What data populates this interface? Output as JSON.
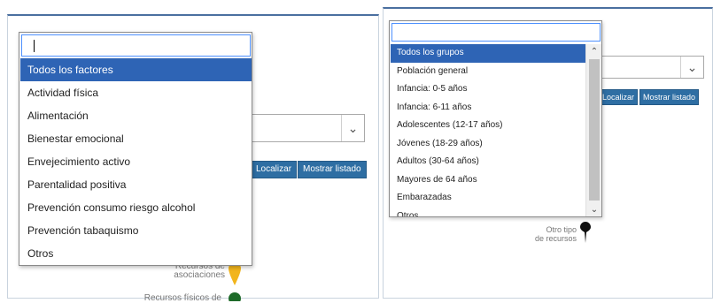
{
  "left": {
    "dropdown": {
      "search_value": "",
      "options": [
        "Todos los factores",
        "Actividad física",
        "Alimentación",
        "Bienestar emocional",
        "Envejecimiento activo",
        "Parentalidad positiva",
        "Prevención consumo riesgo alcohol",
        "Prevención tabaquismo",
        "Otros"
      ],
      "selected_index": 0
    },
    "buttons": {
      "locate": "Localizar",
      "show_list": "Mostrar listado"
    },
    "legend": {
      "associations_line1": "Recursos de",
      "associations_line2": "asociaciones",
      "physical_resources": "Recursos físicos de"
    }
  },
  "right": {
    "dropdown": {
      "search_value": "",
      "options": [
        "Todos los grupos",
        "Población general",
        "Infancia: 0-5 años",
        "Infancia: 6-11 años",
        "Adolescentes (12-17 años)",
        "Jóvenes (18-29 años)",
        "Adultos (30-64 años)",
        "Mayores de 64 años",
        "Embarazadas",
        "Otros"
      ],
      "selected_index": 0
    },
    "buttons": {
      "locate": "Localizar",
      "show_list": "Mostrar listado"
    },
    "legend": {
      "other_type_line1": "Otro tipo",
      "other_type_line2": "de recursos"
    }
  },
  "icons": {
    "chevron": "chevron-down-icon",
    "scroll_up": "scroll-up-icon",
    "scroll_down": "scroll-down-icon",
    "pin_yellow": "map-pin-yellow-icon",
    "pin_green": "map-pin-green-icon",
    "pin_black": "map-pin-black-icon"
  },
  "colors": {
    "button": "#2e6ea3",
    "selected": "#2e64b5",
    "pin_yellow": "#f2b51c",
    "pin_green": "#1f6b2a",
    "pin_black": "#111111"
  }
}
